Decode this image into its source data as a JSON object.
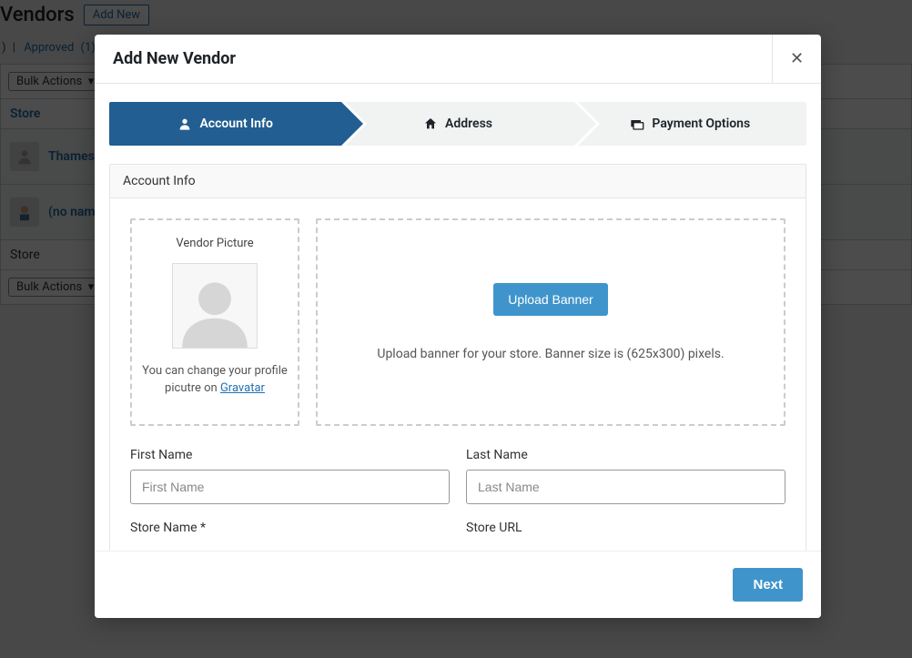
{
  "bg": {
    "heading": "Vendors",
    "add_new": "Add New",
    "subnav_part1": ")",
    "subnav_sep": "|",
    "subnav_approved": "Approved",
    "subnav_count": "(1)",
    "bulk_label": "Bulk Actions",
    "col_store": "Store",
    "row1": "Thames I",
    "row2": "(no name)",
    "footer_store": "Store"
  },
  "modal": {
    "title": "Add New Vendor"
  },
  "stepper": {
    "step1": "Account Info",
    "step2": "Address",
    "step3": "Payment Options"
  },
  "panel": {
    "header": "Account Info",
    "vp_title": "Vendor Picture",
    "vp_hint_pre": "You can change your profile picutre on ",
    "vp_hint_link": "Gravatar",
    "upload_banner": "Upload Banner",
    "banner_hint": "Upload banner for your store. Banner size is (625x300) pixels.",
    "first_name_label": "First Name",
    "first_name_ph": "First Name",
    "last_name_label": "Last Name",
    "last_name_ph": "Last Name",
    "store_name_label": "Store Name *",
    "store_url_label": "Store URL"
  },
  "footer": {
    "next": "Next"
  }
}
